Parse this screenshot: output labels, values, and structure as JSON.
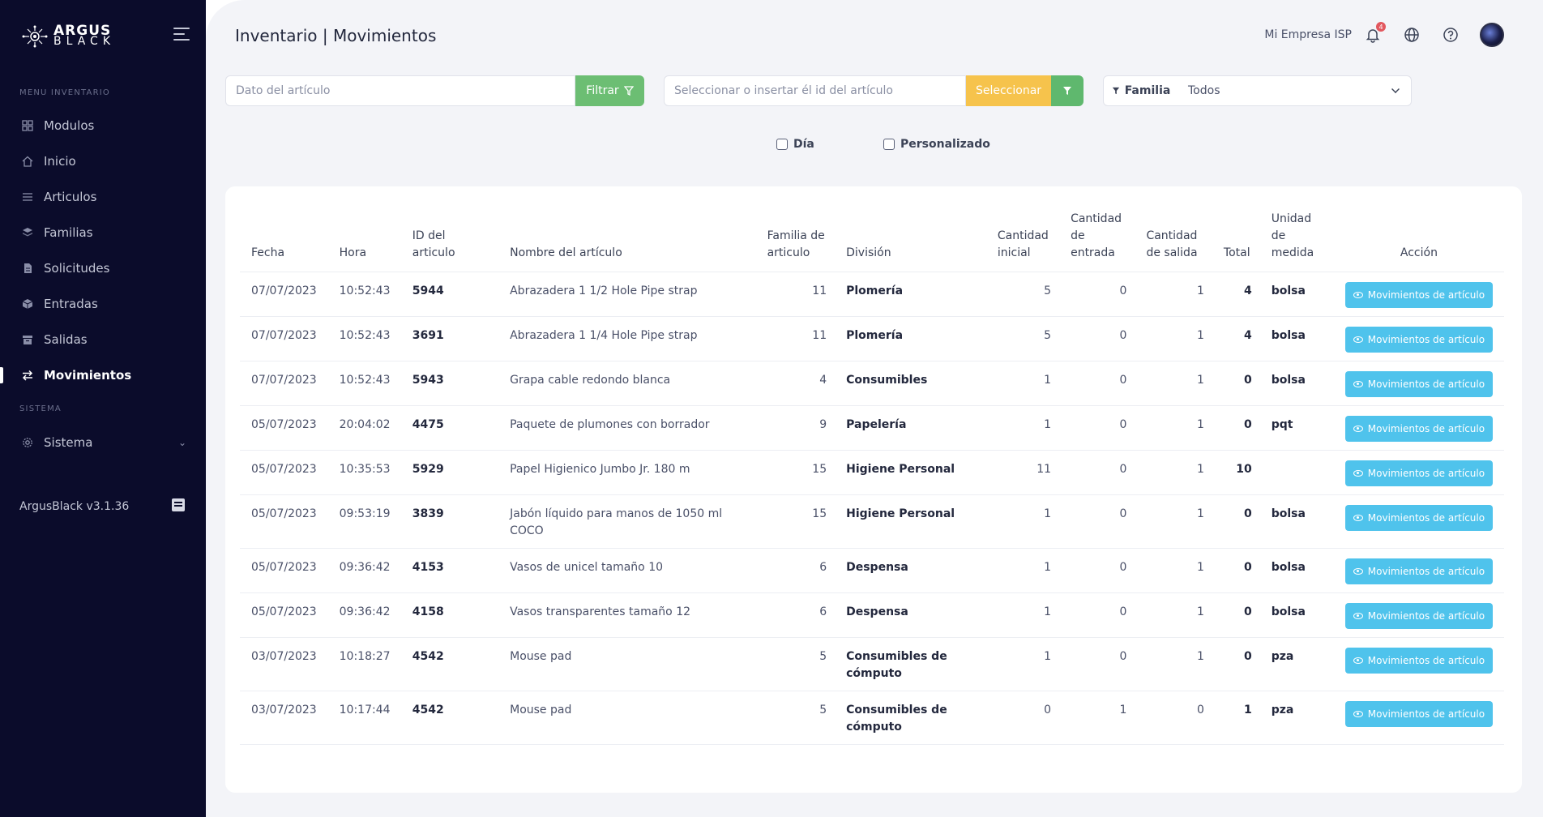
{
  "brand": {
    "line1": "ARGUS",
    "line2": "BLACK"
  },
  "sidebar": {
    "section_inventario": "MENU INVENTARIO",
    "section_sistema": "SISTEMA",
    "items": [
      {
        "label": "Modulos",
        "icon": "grid-icon"
      },
      {
        "label": "Inicio",
        "icon": "home-icon"
      },
      {
        "label": "Articulos",
        "icon": "list-icon"
      },
      {
        "label": "Familias",
        "icon": "layers-icon"
      },
      {
        "label": "Solicitudes",
        "icon": "document-icon"
      },
      {
        "label": "Entradas",
        "icon": "box-icon"
      },
      {
        "label": "Salidas",
        "icon": "archive-icon"
      },
      {
        "label": "Movimientos",
        "icon": "swap-icon",
        "active": true
      }
    ],
    "sistema": {
      "label": "Sistema",
      "icon": "gear-icon"
    },
    "version": "ArgusBlack v3.1.36"
  },
  "header": {
    "title": "Inventario | Movimientos",
    "company": "Mi Empresa ISP",
    "notification_count": "4"
  },
  "filters": {
    "dato_placeholder": "Dato del artículo",
    "filtrar_label": "Filtrar",
    "id_placeholder": "Seleccionar o insertar él id del artículo",
    "seleccionar_label": "Seleccionar",
    "familia_label": "Familia",
    "familia_value": "Todos",
    "check_dia": "Día",
    "check_personalizado": "Personalizado"
  },
  "table": {
    "headers": {
      "fecha": "Fecha",
      "hora": "Hora",
      "id": "ID del articulo",
      "nombre": "Nombre del artículo",
      "familia": "Familia de articulo",
      "division": "División",
      "cant_inicial": "Cantidad inicial",
      "cant_entrada": "Cantidad de entrada",
      "cant_salida": "Cantidad de salida",
      "total": "Total",
      "unidad": "Unidad de medida",
      "accion": "Acción"
    },
    "action_label": "Movimientos de artículo",
    "rows": [
      {
        "fecha": "07/07/2023",
        "hora": "10:52:43",
        "id": "5944",
        "nombre": "Abrazadera 1 1/2 Hole Pipe strap",
        "familia": "11",
        "division": "Plomería",
        "inicial": "5",
        "entrada": "0",
        "salida": "1",
        "total": "4",
        "unidad": "bolsa"
      },
      {
        "fecha": "07/07/2023",
        "hora": "10:52:43",
        "id": "3691",
        "nombre": "Abrazadera 1 1/4 Hole Pipe strap",
        "familia": "11",
        "division": "Plomería",
        "inicial": "5",
        "entrada": "0",
        "salida": "1",
        "total": "4",
        "unidad": "bolsa"
      },
      {
        "fecha": "07/07/2023",
        "hora": "10:52:43",
        "id": "5943",
        "nombre": "Grapa cable redondo blanca",
        "familia": "4",
        "division": "Consumibles",
        "inicial": "1",
        "entrada": "0",
        "salida": "1",
        "total": "0",
        "unidad": "bolsa"
      },
      {
        "fecha": "05/07/2023",
        "hora": "20:04:02",
        "id": "4475",
        "nombre": "Paquete de plumones con borrador",
        "familia": "9",
        "division": "Papelería",
        "inicial": "1",
        "entrada": "0",
        "salida": "1",
        "total": "0",
        "unidad": "pqt"
      },
      {
        "fecha": "05/07/2023",
        "hora": "10:35:53",
        "id": "5929",
        "nombre": "Papel Higienico Jumbo Jr. 180 m",
        "familia": "15",
        "division": "Higiene Personal",
        "inicial": "11",
        "entrada": "0",
        "salida": "1",
        "total": "10",
        "unidad": ""
      },
      {
        "fecha": "05/07/2023",
        "hora": "09:53:19",
        "id": "3839",
        "nombre": "Jabón líquido para manos de 1050 ml COCO",
        "familia": "15",
        "division": "Higiene Personal",
        "inicial": "1",
        "entrada": "0",
        "salida": "1",
        "total": "0",
        "unidad": "bolsa"
      },
      {
        "fecha": "05/07/2023",
        "hora": "09:36:42",
        "id": "4153",
        "nombre": "Vasos de unicel tamaño 10",
        "familia": "6",
        "division": "Despensa",
        "inicial": "1",
        "entrada": "0",
        "salida": "1",
        "total": "0",
        "unidad": "bolsa"
      },
      {
        "fecha": "05/07/2023",
        "hora": "09:36:42",
        "id": "4158",
        "nombre": "Vasos transparentes tamaño 12",
        "familia": "6",
        "division": "Despensa",
        "inicial": "1",
        "entrada": "0",
        "salida": "1",
        "total": "0",
        "unidad": "bolsa"
      },
      {
        "fecha": "03/07/2023",
        "hora": "10:18:27",
        "id": "4542",
        "nombre": "Mouse pad",
        "familia": "5",
        "division": "Consumibles de cómputo",
        "inicial": "1",
        "entrada": "0",
        "salida": "1",
        "total": "0",
        "unidad": "pza"
      },
      {
        "fecha": "03/07/2023",
        "hora": "10:17:44",
        "id": "4542",
        "nombre": "Mouse pad",
        "familia": "5",
        "division": "Consumibles de cómputo",
        "inicial": "0",
        "entrada": "1",
        "salida": "0",
        "total": "1",
        "unidad": "pza"
      }
    ]
  },
  "colors": {
    "sidebar_bg": "#0b0c2b",
    "filtrar_green": "#6cbe73",
    "seleccionar_yellow": "#f6c34c",
    "action_blue": "#4fc3ec",
    "badge_red": "#e2575e"
  }
}
